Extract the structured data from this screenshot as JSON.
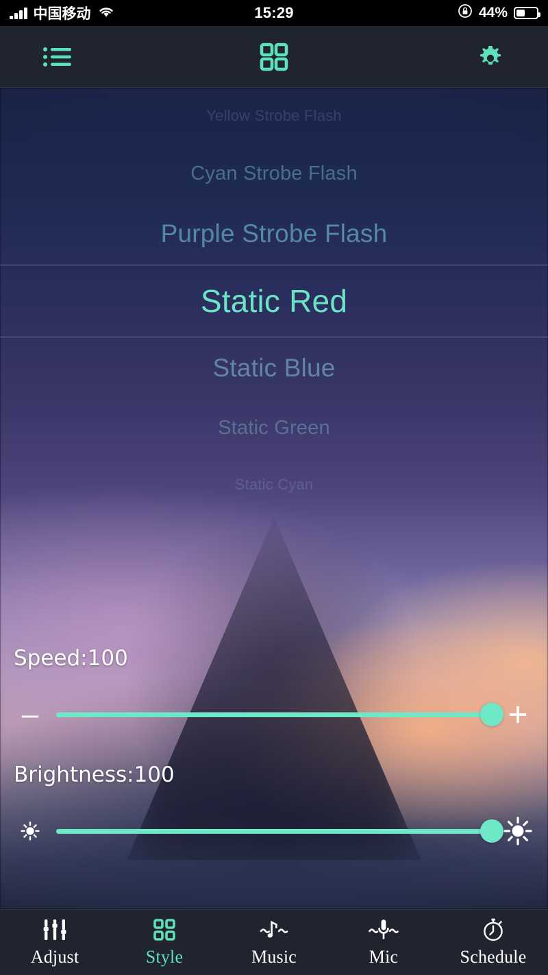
{
  "colors": {
    "accent": "#6fe8c8",
    "accent_tab": "#5fe0bd",
    "navbar_bg": "#20242e",
    "statusbar_bg": "#000000",
    "selected_item": "#6ce3c4",
    "label_text": "#ffffff"
  },
  "statusbar": {
    "carrier": "中国移动",
    "time": "15:29",
    "battery_percent": "44%",
    "battery_level": 44,
    "signal_icon": "signal-bars-icon",
    "wifi_icon": "wifi-icon",
    "rotation_lock_icon": "rotation-lock-icon",
    "battery_icon": "battery-icon"
  },
  "topnav": {
    "left_icon": "list-icon",
    "center_icon": "grid-icon",
    "right_icon": "gear-icon",
    "active": "grid-icon"
  },
  "picker": {
    "selected_index": 3,
    "items": [
      {
        "label": "Yellow Strobe Flash",
        "row": "r0"
      },
      {
        "label": "Cyan Strobe Flash",
        "row": "r1"
      },
      {
        "label": "Purple Strobe Flash",
        "row": "r2"
      },
      {
        "label": "Static Red",
        "row": "sel"
      },
      {
        "label": "Static Blue",
        "row": "b1"
      },
      {
        "label": "Static Green",
        "row": "b2"
      },
      {
        "label": "Static Cyan",
        "row": "b3"
      }
    ]
  },
  "controls": {
    "speed": {
      "label": "Speed:100",
      "value": 100,
      "min": 0,
      "max": 100,
      "percent": "100%",
      "left_icon": "minus-icon",
      "right_icon": "plus-icon",
      "left_glyph": "–",
      "right_glyph": "+"
    },
    "brightness": {
      "label": "Brightness:100",
      "value": 100,
      "min": 0,
      "max": 100,
      "percent": "100%",
      "left_icon": "brightness-low-icon",
      "right_icon": "brightness-high-icon"
    }
  },
  "tabbar": {
    "active": "Style",
    "tabs": [
      {
        "label": "Adjust",
        "icon": "sliders-icon"
      },
      {
        "label": "Style",
        "icon": "grid-icon"
      },
      {
        "label": "Music",
        "icon": "music-note-icon"
      },
      {
        "label": "Mic",
        "icon": "microphone-icon"
      },
      {
        "label": "Schedule",
        "icon": "stopwatch-icon"
      }
    ]
  }
}
